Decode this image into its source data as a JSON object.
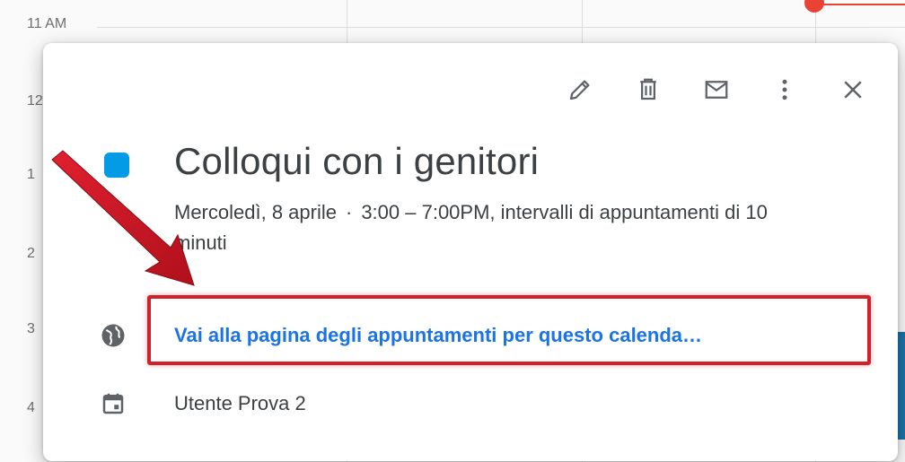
{
  "calendar": {
    "hour_labels": [
      "11 AM",
      "12",
      "1",
      "2",
      "3",
      "4"
    ]
  },
  "popup": {
    "toolbar": {
      "edit_icon": "pencil-icon",
      "delete_icon": "trash-icon",
      "email_icon": "email-icon",
      "more_icon": "more-vert-icon",
      "close_icon": "close-icon"
    },
    "event_color": "#039be5",
    "title": "Colloqui con i genitori",
    "date": "Mercoledì, 8 aprile",
    "separator": "·",
    "time_details": "3:00 – 7:00PM, intervalli di appuntamenti di 10 minuti",
    "booking_link": {
      "icon": "globe-icon",
      "label": "Vai alla pagina degli appuntamenti per questo calenda…"
    },
    "calendar_owner": {
      "icon": "calendar-icon",
      "label": "Utente Prova 2"
    }
  },
  "annotation": {
    "highlight_color": "#d3202b"
  }
}
